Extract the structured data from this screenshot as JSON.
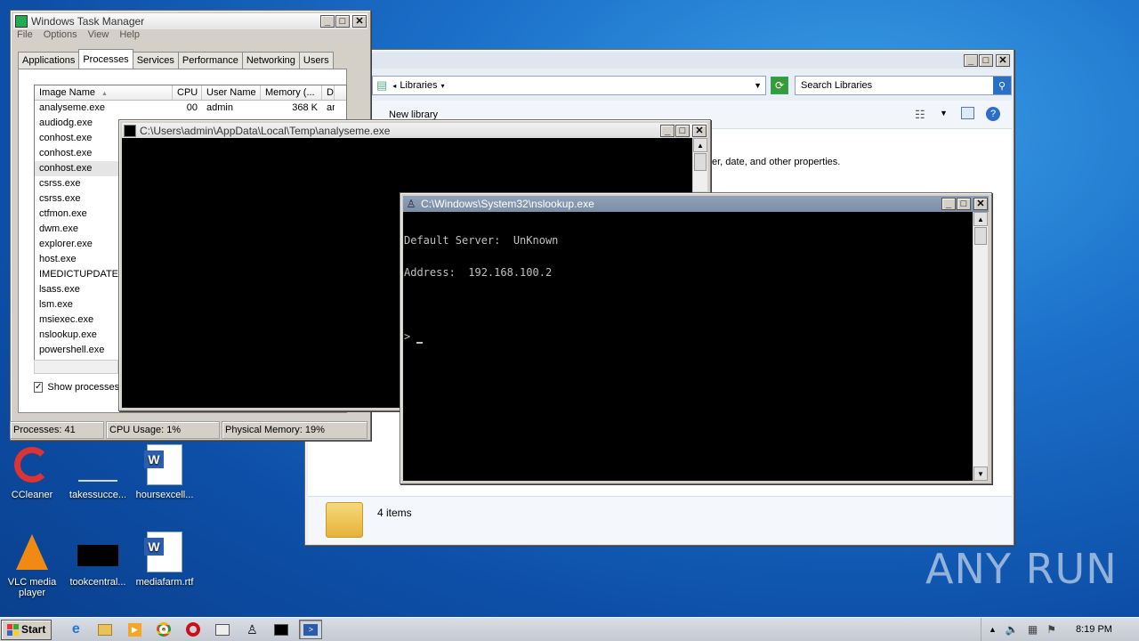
{
  "taskmanager": {
    "title": "Windows Task Manager",
    "menu": [
      "File",
      "Options",
      "View",
      "Help"
    ],
    "tabs": [
      "Applications",
      "Processes",
      "Services",
      "Performance",
      "Networking",
      "Users"
    ],
    "active_tab": "Processes",
    "columns": [
      "Image Name",
      "CPU",
      "User Name",
      "Memory (...",
      "D"
    ],
    "rows": [
      {
        "name": "analyseme.exe",
        "cpu": "00",
        "user": "admin",
        "mem": "368 K",
        "d": "ar"
      },
      {
        "name": "audiodg.exe"
      },
      {
        "name": "conhost.exe"
      },
      {
        "name": "conhost.exe"
      },
      {
        "name": "conhost.exe",
        "selected": true
      },
      {
        "name": "csrss.exe"
      },
      {
        "name": "csrss.exe"
      },
      {
        "name": "ctfmon.exe"
      },
      {
        "name": "dwm.exe"
      },
      {
        "name": "explorer.exe"
      },
      {
        "name": "host.exe"
      },
      {
        "name": "IMEDICTUPDATE.E"
      },
      {
        "name": "lsass.exe"
      },
      {
        "name": "lsm.exe"
      },
      {
        "name": "msiexec.exe"
      },
      {
        "name": "nslookup.exe"
      },
      {
        "name": "powershell.exe"
      }
    ],
    "show_processes_label": "Show processes",
    "status": {
      "processes": "Processes: 41",
      "cpu": "CPU Usage: 1%",
      "memory": "Physical Memory: 19%"
    }
  },
  "explorer": {
    "address": "Libraries",
    "search_placeholder": "Search Libraries",
    "new_library": "New library",
    "description_fragment": "er, date, and other properties.",
    "items_count": "4 items"
  },
  "console1": {
    "title": "C:\\Users\\admin\\AppData\\Local\\Temp\\analyseme.exe"
  },
  "console2": {
    "title": "C:\\Windows\\System32\\nslookup.exe",
    "line1": "Default Server:  UnKnown",
    "line2": "Address:  192.168.100.2",
    "prompt": ">"
  },
  "desktop_icons": [
    {
      "label": "CCleaner",
      "icon": "ccleaner-icon"
    },
    {
      "label": "takessucce...",
      "icon": "blank-file-icon"
    },
    {
      "label": "hoursexcell...",
      "icon": "word-doc-icon"
    },
    {
      "label": "VLC media player",
      "icon": "vlc-icon"
    },
    {
      "label": "tookcentral...",
      "icon": "black-file-icon"
    },
    {
      "label": "mediafarm.rtf",
      "icon": "word-doc-icon"
    }
  ],
  "taskbar": {
    "start_label": "Start",
    "clock": "8:19 PM"
  },
  "watermark": "ANY RUN"
}
